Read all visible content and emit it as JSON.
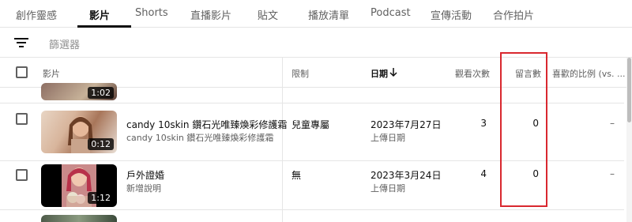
{
  "tabs": [
    {
      "label": "創作靈感",
      "active": false
    },
    {
      "label": "影片",
      "active": true
    },
    {
      "label": "Shorts",
      "active": false
    },
    {
      "label": "直播影片",
      "active": false
    },
    {
      "label": "貼文",
      "active": false
    },
    {
      "label": "播放清單",
      "active": false
    },
    {
      "label": "Podcast",
      "active": false
    },
    {
      "label": "宣傳活動",
      "active": false
    },
    {
      "label": "合作拍片",
      "active": false
    }
  ],
  "filter": {
    "icon": "filter-icon",
    "placeholder": "篩選器"
  },
  "columns": {
    "video": "影片",
    "restriction": "限制",
    "date": "日期",
    "date_sort_icon": "arrow-down-icon",
    "views": "觀看次數",
    "comments": "留言數",
    "likes": "喜歡的比例 (vs. ..."
  },
  "rows": [
    {
      "duration": "1:02",
      "partial": true
    },
    {
      "title": "candy 10skin 鑽石光唯臻煥彩修護霜",
      "description": "candy 10skin 鑽石光唯臻煥彩修護霜",
      "duration": "0:12",
      "restriction": "兒童專屬",
      "date": "2023年7月27日",
      "date_sub": "上傳日期",
      "views": "3",
      "comments": "0",
      "likes": "–"
    },
    {
      "title": "戶外證婚",
      "description": "新增說明",
      "duration": "1:12",
      "restriction": "無",
      "date": "2023年3月24日",
      "date_sub": "上傳日期",
      "views": "4",
      "comments": "0",
      "likes": "–"
    }
  ],
  "colors": {
    "highlight_border": "#d9282f",
    "text_primary": "#0f0f0f",
    "text_secondary": "#606060"
  }
}
